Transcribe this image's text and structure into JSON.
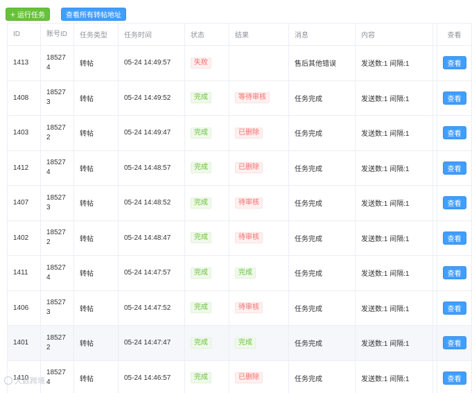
{
  "toolbar": {
    "run_task_label": "运行任务",
    "view_all_label": "查看所有转帖地址"
  },
  "columns": [
    "ID",
    "账号ID",
    "任务类型",
    "任务时间",
    "状态",
    "结果",
    "消息",
    "内容",
    "查看"
  ],
  "rows": [
    {
      "id": "1413",
      "account": "185274",
      "type": "转帖",
      "time": "05-24 14:49:57",
      "state": "失败",
      "state_kind": "danger",
      "result": "",
      "result_kind": "",
      "message": "售后其他错误",
      "content": "发送数:1 间隔:1",
      "view": "查看"
    },
    {
      "id": "1408",
      "account": "185273",
      "type": "转帖",
      "time": "05-24 14:49:52",
      "state": "完成",
      "state_kind": "success",
      "result": "等待审核",
      "result_kind": "danger",
      "message": "任务完成",
      "content": "发送数:1 间隔:1",
      "view": "查看"
    },
    {
      "id": "1403",
      "account": "185272",
      "type": "转帖",
      "time": "05-24 14:49:47",
      "state": "完成",
      "state_kind": "success",
      "result": "已删除",
      "result_kind": "danger",
      "message": "任务完成",
      "content": "发送数:1 间隔:1",
      "view": "查看"
    },
    {
      "id": "1412",
      "account": "185274",
      "type": "转帖",
      "time": "05-24 14:48:57",
      "state": "完成",
      "state_kind": "success",
      "result": "已删除",
      "result_kind": "danger",
      "message": "任务完成",
      "content": "发送数:1 间隔:1",
      "view": "查看"
    },
    {
      "id": "1407",
      "account": "185273",
      "type": "转帖",
      "time": "05-24 14:48:52",
      "state": "完成",
      "state_kind": "success",
      "result": "待审核",
      "result_kind": "danger",
      "message": "任务完成",
      "content": "发送数:1 间隔:1",
      "view": "查看"
    },
    {
      "id": "1402",
      "account": "185272",
      "type": "转帖",
      "time": "05-24 14:48:47",
      "state": "完成",
      "state_kind": "success",
      "result": "待审核",
      "result_kind": "danger",
      "message": "任务完成",
      "content": "发送数:1 间隔:1",
      "view": "查看"
    },
    {
      "id": "1411",
      "account": "185274",
      "type": "转帖",
      "time": "05-24 14:47:57",
      "state": "完成",
      "state_kind": "success",
      "result": "完成",
      "result_kind": "success",
      "message": "任务完成",
      "content": "发送数:1 间隔:1",
      "view": "查看"
    },
    {
      "id": "1406",
      "account": "185273",
      "type": "转帖",
      "time": "05-24 14:47:52",
      "state": "完成",
      "state_kind": "success",
      "result": "待审核",
      "result_kind": "danger",
      "message": "任务完成",
      "content": "发送数:1 间隔:1",
      "view": "查看"
    },
    {
      "id": "1401",
      "account": "185272",
      "type": "转帖",
      "time": "05-24 14:47:47",
      "state": "完成",
      "state_kind": "success",
      "result": "完成",
      "result_kind": "success",
      "message": "任务完成",
      "content": "发送数:1 间隔:1",
      "view": "查看",
      "highlight": true
    },
    {
      "id": "1410",
      "account": "185274",
      "type": "转帖",
      "time": "05-24 14:46:57",
      "state": "完成",
      "state_kind": "success",
      "result": "已删除",
      "result_kind": "danger",
      "message": "任务完成",
      "content": "发送数:1 间隔:1",
      "view": "查看"
    }
  ],
  "watermark": "大数跨境",
  "colors": {
    "primary": "#409eff",
    "success": "#67c23a",
    "danger": "#f56c6c",
    "border": "#ebeef5"
  }
}
